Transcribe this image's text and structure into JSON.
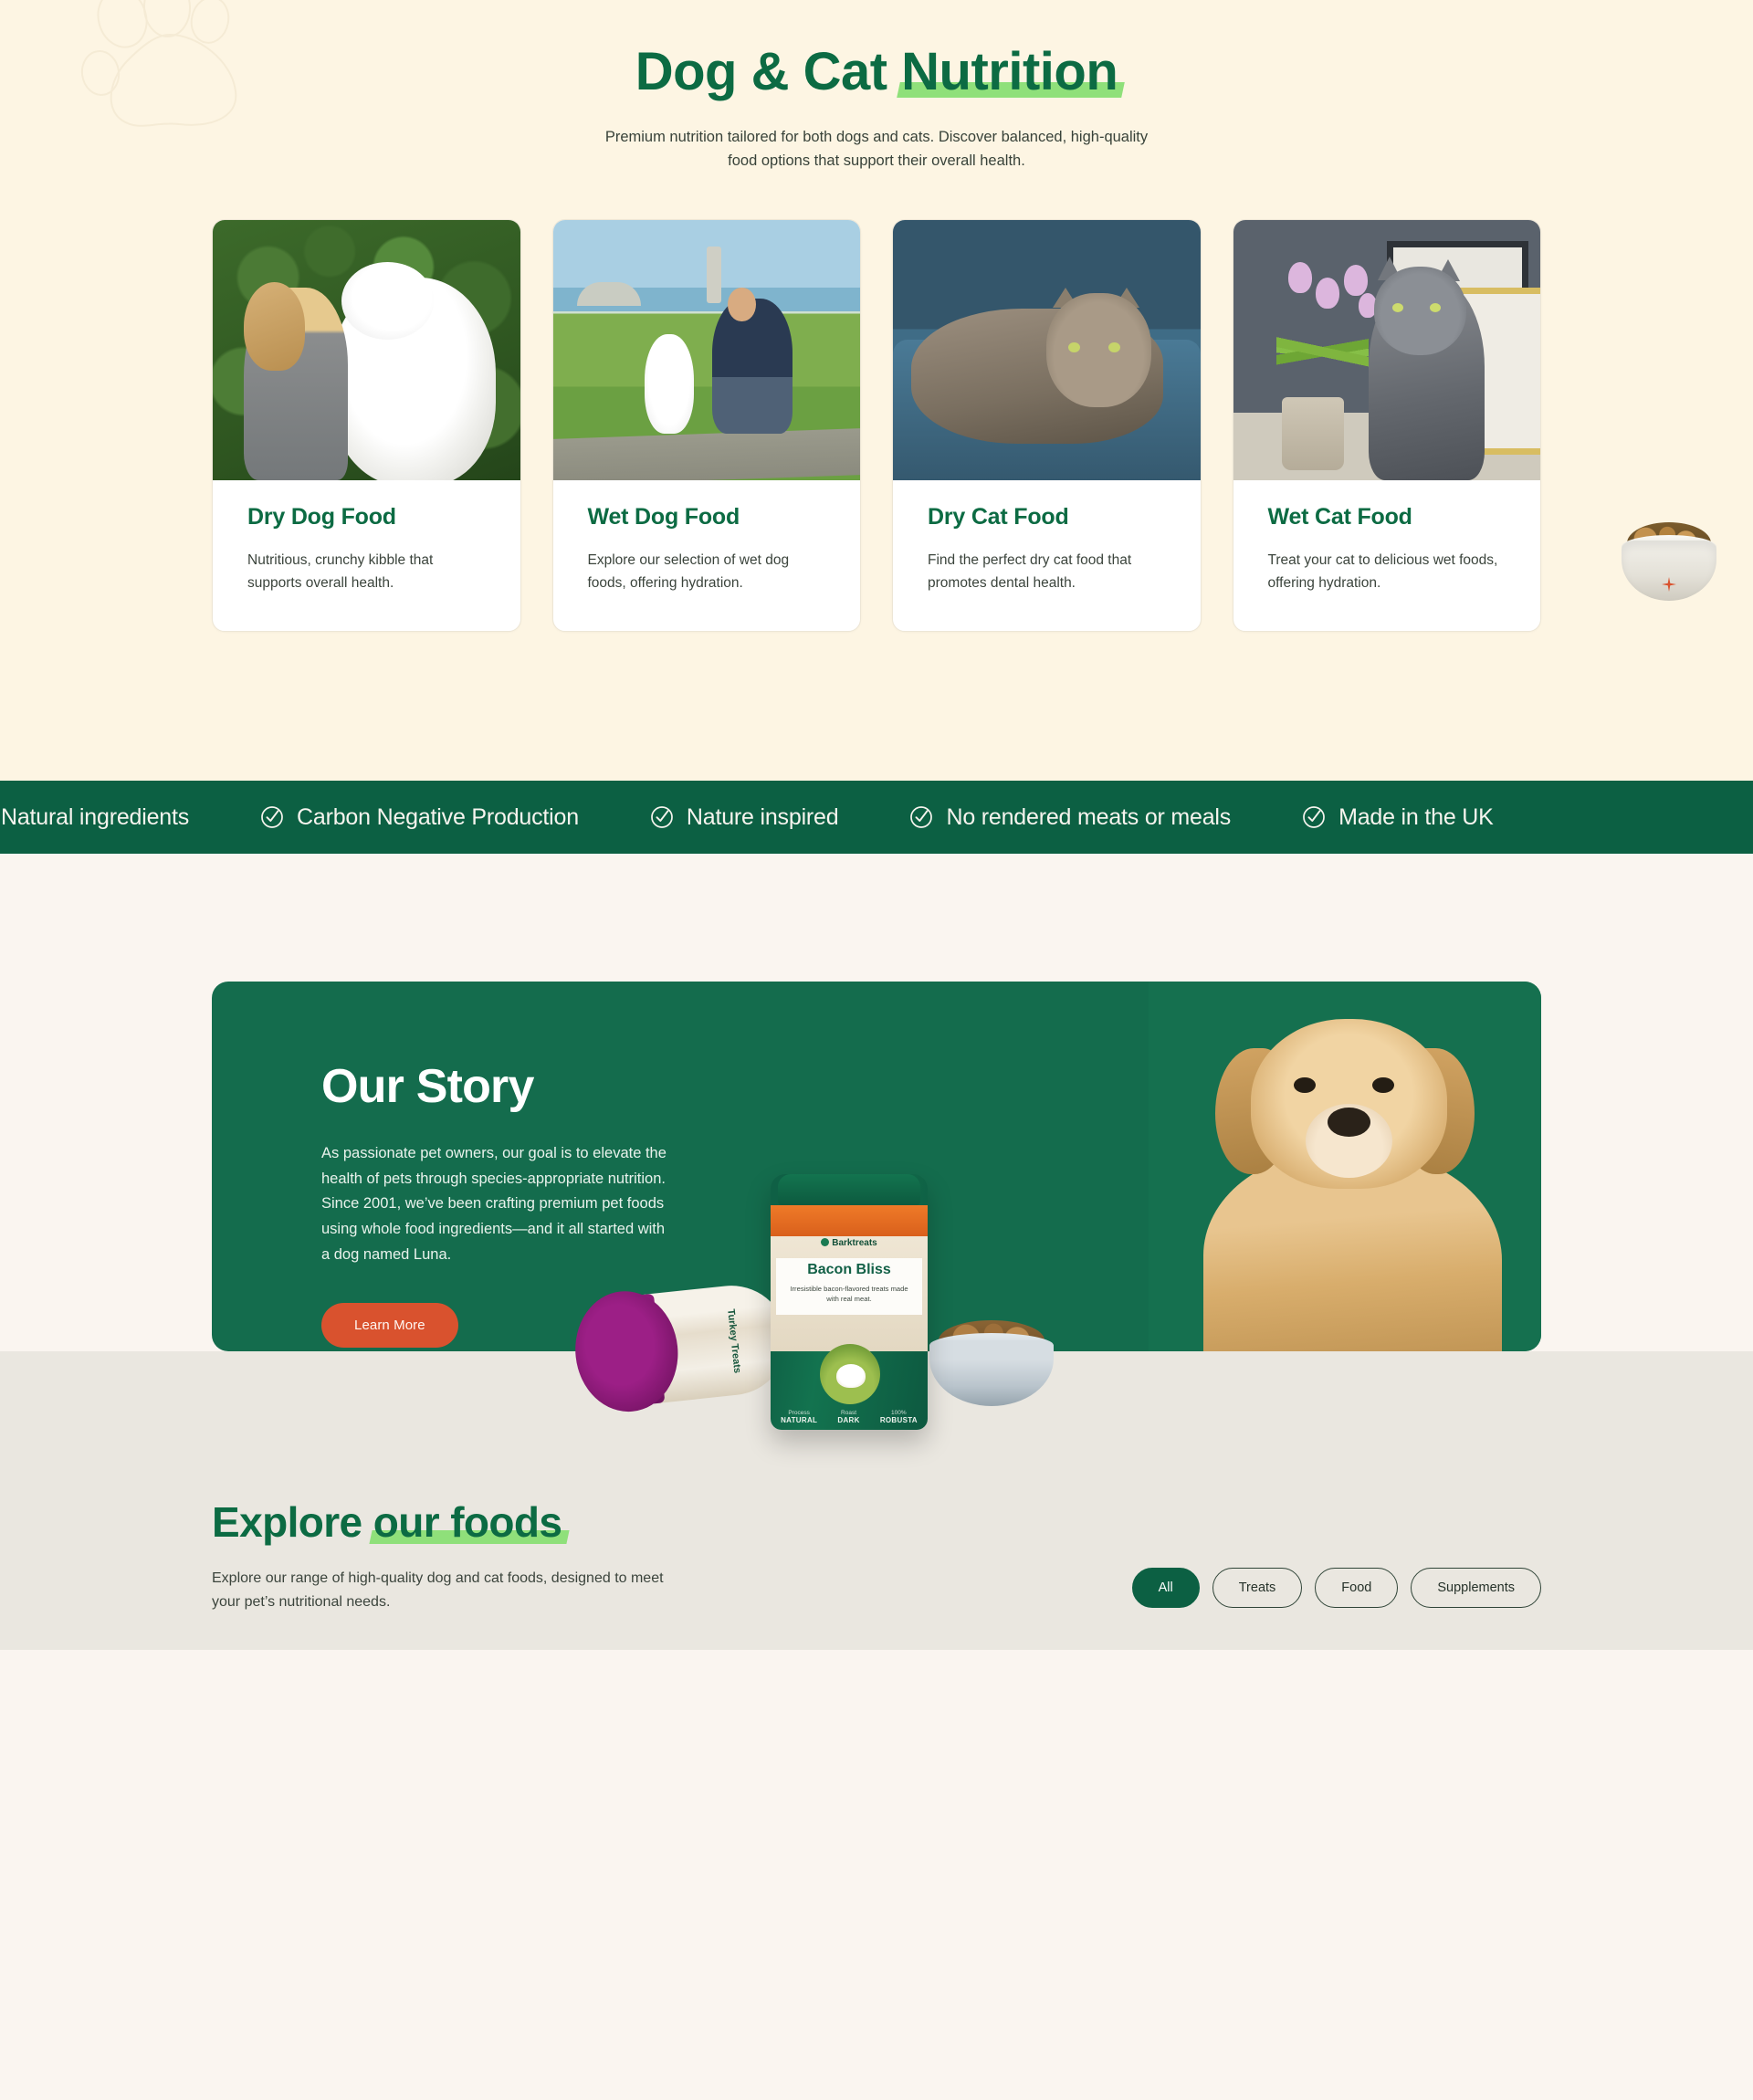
{
  "hero": {
    "title_part1": "Dog & Cat ",
    "title_highlight": "Nutrition",
    "subtitle": "Premium nutrition tailored for both dogs and cats. Discover balanced, high-quality food options that support their overall health.",
    "paw_icon": "paw-print-icon"
  },
  "cards": [
    {
      "title": "Dry Dog Food",
      "desc": "Nutritious, crunchy kibble that supports overall health.",
      "image_alt": "woman holding white fluffy dog outdoors"
    },
    {
      "title": "Wet Dog Food",
      "desc": "Explore our selection of wet dog foods, offering hydration.",
      "image_alt": "man training white puppy on grass by the beach"
    },
    {
      "title": "Dry Cat Food",
      "desc": "Find the perfect dry cat food that promotes dental health.",
      "image_alt": "tabby cat lying on a blue couch"
    },
    {
      "title": "Wet Cat Food",
      "desc": "Treat your cat to delicious wet foods, offering hydration.",
      "image_alt": "grey cat beside purple tulips and picture frames"
    }
  ],
  "floating_bowl": {
    "name": "dog-food-bowl",
    "star_color": "#D9522E"
  },
  "marquee": {
    "background": "#0C6043",
    "items": [
      "Natural ingredients",
      "Carbon Negative Production",
      "Nature inspired",
      "No rendered meats or meals",
      "Made in the UK"
    ],
    "check_icon": "check-circle-icon"
  },
  "story": {
    "title": "Our Story",
    "text": "As passionate pet owners, our goal is to elevate the health of pets through species-appropriate nutrition. Since 2001, we’ve been crafting premium pet foods using whole food ingredients—and it all started with a dog named Luna.",
    "button_label": "Learn More",
    "background": "#146C4D",
    "button_color": "#D9522E",
    "dog_image_alt": "golden retriever portrait"
  },
  "products": {
    "purple_tub": {
      "brand": "Barktreats",
      "name": "Turkey Treats"
    },
    "green_jar": {
      "brand": "Barktreats",
      "name": "Bacon Bliss",
      "desc": "Irresistible bacon-flavored treats made with real meat.",
      "specs": [
        {
          "key": "Process",
          "value": "NATURAL"
        },
        {
          "key": "Roast",
          "value": "DARK"
        },
        {
          "key": "100%",
          "value": "ROBUSTA"
        }
      ]
    },
    "food_bowl": "kibble-bowl"
  },
  "explore": {
    "title_part1": "Explore ",
    "title_highlight": "our foods",
    "subtitle": "Explore our range of high-quality dog and cat foods, designed to meet your pet’s nutritional needs.",
    "filters": [
      {
        "label": "All",
        "active": true
      },
      {
        "label": "Treats",
        "active": false
      },
      {
        "label": "Food",
        "active": false
      },
      {
        "label": "Supplements",
        "active": false
      }
    ]
  },
  "colors": {
    "hero_bg": "#FDF5E3",
    "page_bg": "#FAF5F0",
    "explore_bg": "#EAE7E0",
    "brand_green": "#0C6B43",
    "highlight_green": "#8FE07A",
    "accent_orange": "#D9522E"
  }
}
